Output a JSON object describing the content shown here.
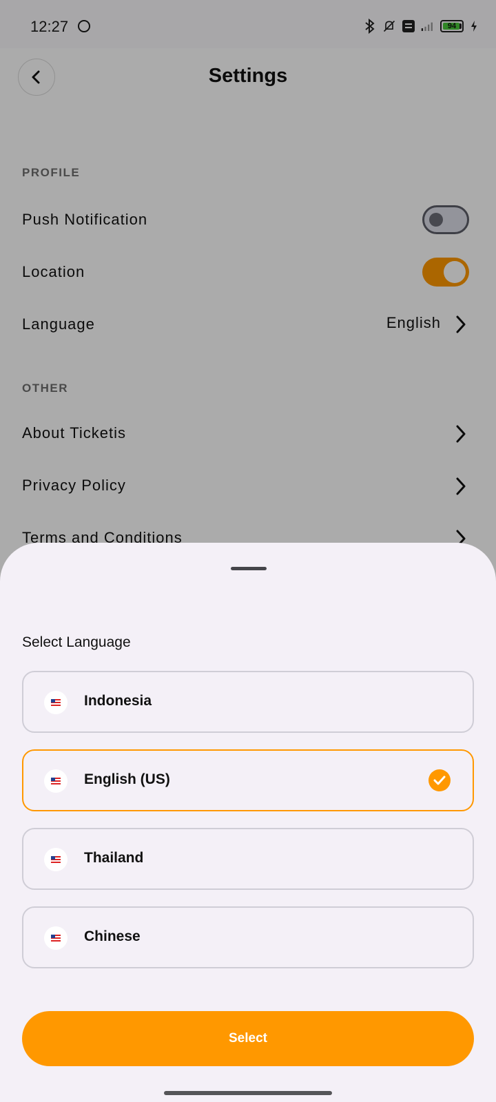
{
  "status_bar": {
    "time": "12:27",
    "battery_level": "94",
    "icons": [
      "face-icon",
      "bluetooth-icon",
      "mute-icon",
      "volte-icon",
      "signal-icon",
      "battery-icon",
      "charging-icon"
    ]
  },
  "header": {
    "title": "Settings",
    "back_icon": "chevron-left-icon"
  },
  "profile": {
    "section_label": "PROFILE",
    "push_notification": {
      "label": "Push Notification",
      "enabled": false
    },
    "location": {
      "label": "Location",
      "enabled": true
    },
    "language": {
      "label": "Language",
      "value": "English"
    }
  },
  "other": {
    "section_label": "OTHER",
    "items": [
      {
        "label": "About Ticketis"
      },
      {
        "label": "Privacy Policy"
      },
      {
        "label": "Terms and Conditions"
      }
    ]
  },
  "language_sheet": {
    "title": "Select Language",
    "options": [
      {
        "name": "Indonesia",
        "flag_icon": "us-flag-icon",
        "selected": false
      },
      {
        "name": "English (US)",
        "flag_icon": "us-flag-icon",
        "selected": true
      },
      {
        "name": "Thailand",
        "flag_icon": "us-flag-icon",
        "selected": false
      },
      {
        "name": "Chinese",
        "flag_icon": "us-flag-icon",
        "selected": false
      }
    ],
    "select_label": "Select"
  },
  "colors": {
    "accent": "#ff9800",
    "sheet_background": "#f4f0f7",
    "option_border": "#cfcdd6"
  }
}
